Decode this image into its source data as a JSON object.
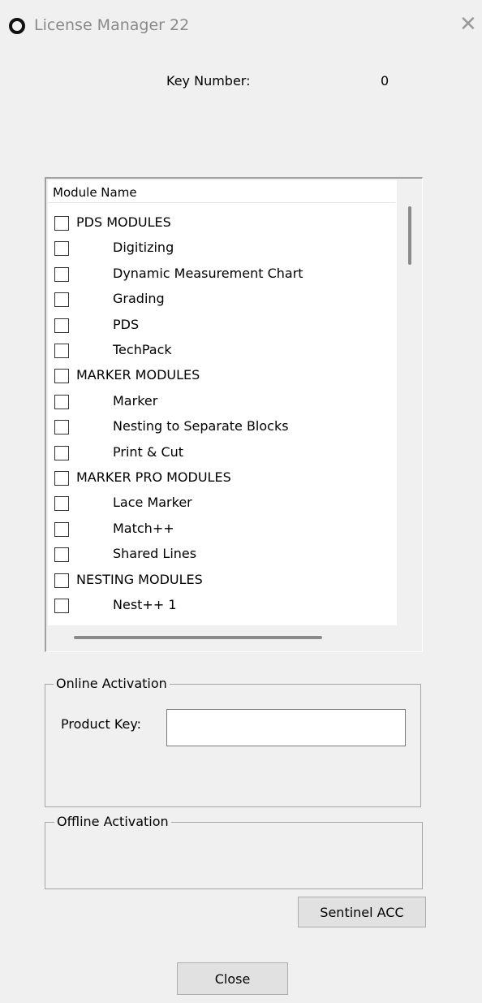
{
  "window": {
    "title": "License Manager 22",
    "icon": "circle-logo-icon",
    "close_glyph": "✕"
  },
  "key": {
    "label": "Key Number:",
    "value": "0"
  },
  "modules": {
    "header": "Module Name",
    "rows": [
      {
        "label": "PDS MODULES",
        "group": true,
        "checked": false
      },
      {
        "label": "Digitizing",
        "group": false,
        "checked": false
      },
      {
        "label": "Dynamic Measurement Chart",
        "group": false,
        "checked": false
      },
      {
        "label": "Grading",
        "group": false,
        "checked": false
      },
      {
        "label": "PDS",
        "group": false,
        "checked": false
      },
      {
        "label": "TechPack",
        "group": false,
        "checked": false
      },
      {
        "label": "MARKER MODULES",
        "group": true,
        "checked": false
      },
      {
        "label": "Marker",
        "group": false,
        "checked": false
      },
      {
        "label": "Nesting to Separate Blocks",
        "group": false,
        "checked": false
      },
      {
        "label": "Print & Cut",
        "group": false,
        "checked": false
      },
      {
        "label": "MARKER PRO MODULES",
        "group": true,
        "checked": false
      },
      {
        "label": "Lace Marker",
        "group": false,
        "checked": false
      },
      {
        "label": "Match++",
        "group": false,
        "checked": false
      },
      {
        "label": "Shared Lines",
        "group": false,
        "checked": false
      },
      {
        "label": "NESTING MODULES",
        "group": true,
        "checked": false
      },
      {
        "label": "Nest++ 1",
        "group": false,
        "checked": false
      }
    ]
  },
  "online": {
    "legend": "Online Activation",
    "product_key_label": "Product Key:",
    "product_key_value": ""
  },
  "offline": {
    "legend": "Offline Activation"
  },
  "buttons": {
    "sentinel": "Sentinel ACC",
    "close": "Close"
  }
}
